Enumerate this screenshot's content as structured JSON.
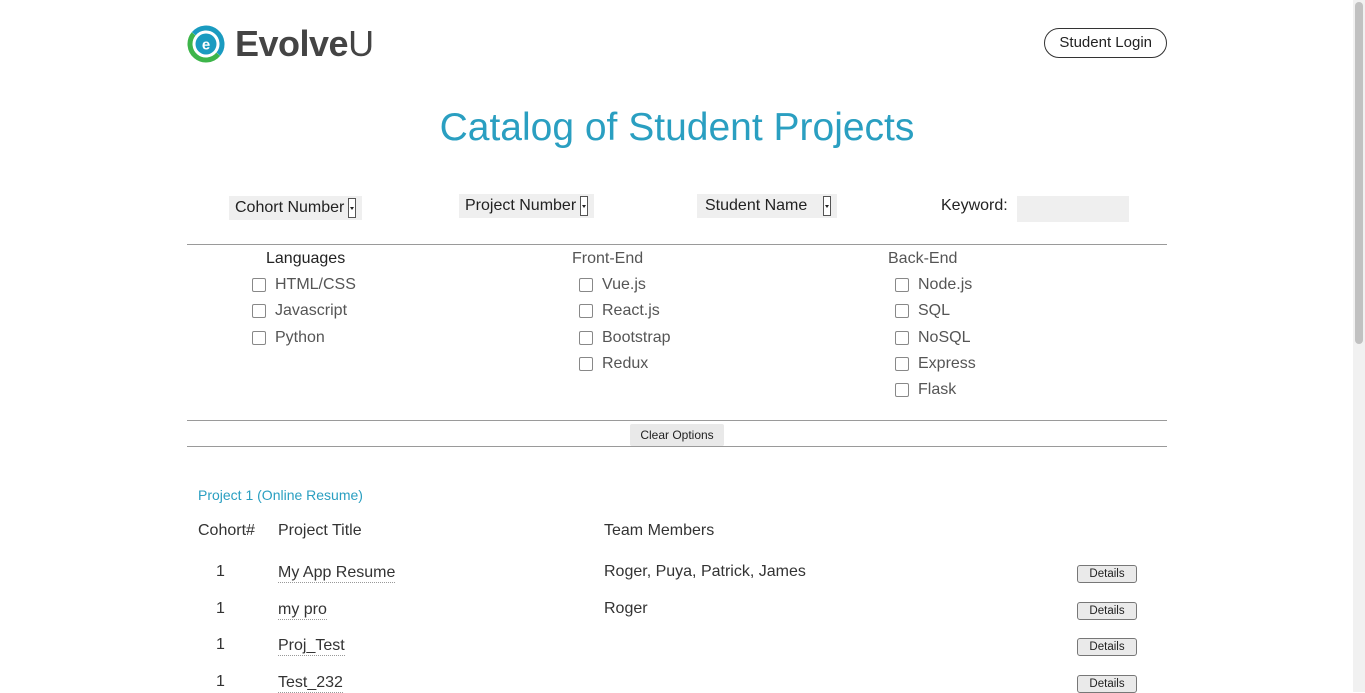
{
  "brand": {
    "name_bold": "Evolve",
    "name_light": "U",
    "colors": {
      "ring_teal": "#1a9bc0",
      "ring_green": "#3db54a"
    }
  },
  "header": {
    "login_label": "Student Login"
  },
  "title": "Catalog of Student Projects",
  "filters": {
    "cohort": "Cohort Number",
    "project": "Project Number",
    "student": "Student Name",
    "keyword_label": "Keyword:",
    "keyword_value": ""
  },
  "categories": {
    "languages": {
      "title": "Languages",
      "items": [
        "HTML/CSS",
        "Javascript",
        "Python"
      ]
    },
    "frontend": {
      "title": "Front-End",
      "items": [
        "Vue.js",
        "React.js",
        "Bootstrap",
        "Redux"
      ]
    },
    "backend": {
      "title": "Back-End",
      "items": [
        "Node.js",
        "SQL",
        "NoSQL",
        "Express",
        "Flask"
      ]
    }
  },
  "clear_label": "Clear Options",
  "projects": {
    "section_title": "Project 1 (Online Resume)",
    "headers": {
      "cohort": "Cohort#",
      "title": "Project Title",
      "team": "Team Members"
    },
    "rows": [
      {
        "cohort": "1",
        "title": "My App Resume",
        "team": "Roger, Puya, Patrick, James",
        "details": "Details"
      },
      {
        "cohort": "1",
        "title": "my pro",
        "team": "Roger",
        "details": "Details"
      },
      {
        "cohort": "1",
        "title": "Proj_Test",
        "team": "",
        "details": "Details"
      },
      {
        "cohort": "1",
        "title": "Test_232",
        "team": "",
        "details": "Details"
      }
    ]
  },
  "colors": {
    "accent": "#2a9fc1"
  }
}
